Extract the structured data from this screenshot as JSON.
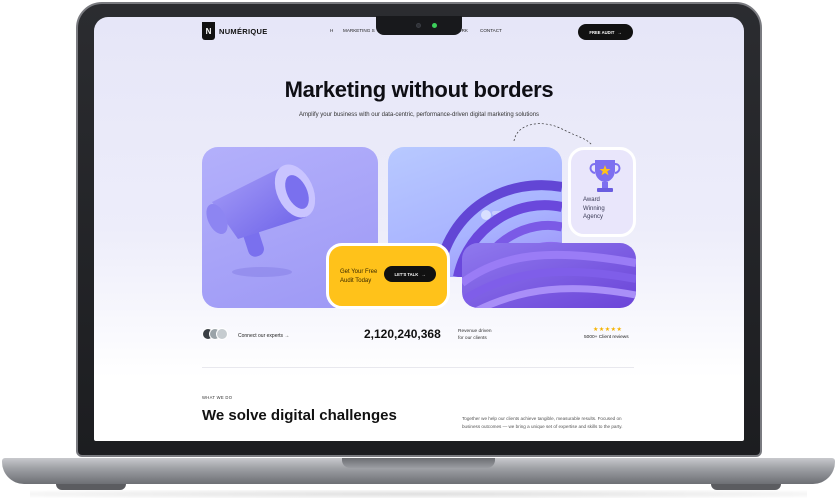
{
  "nav": {
    "logo_letter": "N",
    "logo_text": "NUMÉRIQUE",
    "links": [
      "H",
      "MARKETING S",
      "ORK",
      "CONTACT"
    ],
    "cta_label": "FREE AUDIT"
  },
  "hero": {
    "title": "Marketing without borders",
    "subtitle": "Amplify your business with our data-centric, performance-driven digital marketing solutions"
  },
  "award": {
    "line1": "Award",
    "line2": "Winning",
    "line3": "Agency"
  },
  "audit_card": {
    "line1": "Get Your Free",
    "line2": "Audit Today",
    "button_label": "LET'S TALK"
  },
  "stats": {
    "connect_label": "Connect our experts",
    "revenue_number": "2,120,240,368",
    "revenue_line1": "Revenue driven",
    "revenue_line2": "for our clients",
    "stars": "★★★★★",
    "reviews_label": "5000+ Client reviews"
  },
  "section": {
    "eyebrow": "WHAT WE DO",
    "heading": "We solve digital challenges",
    "body": "Together we help our clients achieve tangible, measurable results. Focused on business outcomes — we bring a unique set of expertise and skills to the party."
  },
  "colors": {
    "accent_yellow": "#ffc21a",
    "accent_purple": "#9d98f5",
    "dark": "#111111"
  }
}
